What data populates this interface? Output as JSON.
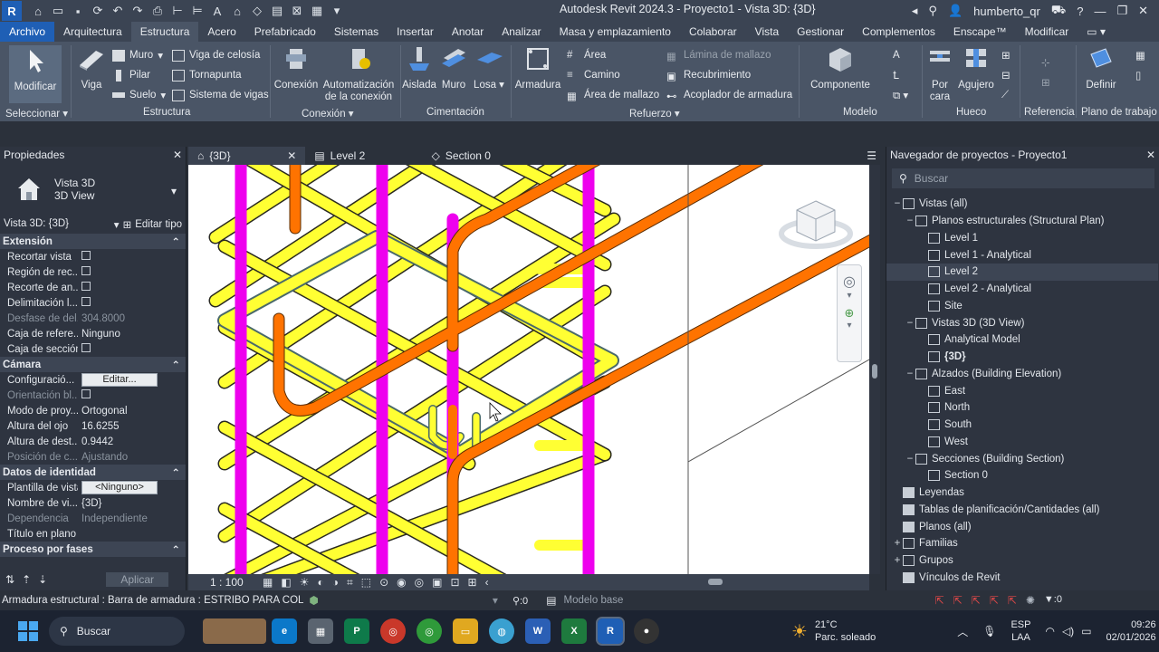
{
  "app": {
    "title": "Autodesk Revit 2024.3 - Proyecto1 - Vista 3D: {3D}",
    "logo": "R",
    "user": "humberto_qr"
  },
  "menu": [
    "Archivo",
    "Arquitectura",
    "Estructura",
    "Acero",
    "Prefabricado",
    "Sistemas",
    "Insertar",
    "Anotar",
    "Analizar",
    "Masa y emplazamiento",
    "Colaborar",
    "Vista",
    "Gestionar",
    "Complementos",
    "Enscape™",
    "Modificar"
  ],
  "ribbon": {
    "seleccionar": {
      "btn": "Modificar",
      "label": "Seleccionar"
    },
    "estructura": {
      "viga": "Viga",
      "muro": "Muro",
      "pilar": "Pilar",
      "suelo": "Suelo",
      "celosia": "Viga de celosía",
      "tornapunta": "Tornapunta",
      "sistema": "Sistema de vigas",
      "label": "Estructura"
    },
    "conexion": {
      "conexion": "Conexión",
      "auto1": "Automatización",
      "auto2": "de la conexión",
      "label": "Conexión"
    },
    "cimentacion": {
      "aislada": "Aislada",
      "muro": "Muro",
      "losa": "Losa",
      "label": "Cimentación"
    },
    "refuerzo": {
      "armadura": "Armadura",
      "area": "Área",
      "camino": "Camino",
      "area_mallazo": "Área de mallazo",
      "lamina": "Lámina de mallazo",
      "recubrimiento": "Recubrimiento",
      "acoplador": "Acoplador de armadura",
      "label": "Refuerzo"
    },
    "modelo": {
      "componente": "Componente",
      "label": "Modelo"
    },
    "hueco": {
      "porcara1": "Por",
      "porcara2": "cara",
      "agujero": "Agujero",
      "label": "Hueco"
    },
    "referencia": {
      "label": "Referencia"
    },
    "plano": {
      "definir": "Definir",
      "label": "Plano de trabajo"
    }
  },
  "properties": {
    "title": "Propiedades",
    "type_name": "Vista 3D",
    "type_sub": "3D View",
    "selector": "Vista 3D: {3D}",
    "edit_type": "Editar tipo",
    "sections": [
      {
        "name": "Extensión",
        "rows": [
          {
            "k": "Recortar vista",
            "check": true
          },
          {
            "k": "Región de rec...",
            "check": true
          },
          {
            "k": "Recorte de an...",
            "check": true
          },
          {
            "k": "Delimitación l...",
            "check": true
          },
          {
            "k": "Desfase de del...",
            "v": "304.8000",
            "dis": true
          },
          {
            "k": "Caja de refere...",
            "v": "Ninguno"
          },
          {
            "k": "Caja de sección",
            "check": true
          }
        ]
      },
      {
        "name": "Cámara",
        "rows": [
          {
            "k": "Configuració...",
            "btn": "Editar..."
          },
          {
            "k": "Orientación bl...",
            "check": true,
            "dis": true
          },
          {
            "k": "Modo de proy...",
            "v": "Ortogonal"
          },
          {
            "k": "Altura del ojo",
            "v": "16.6255"
          },
          {
            "k": "Altura de dest...",
            "v": "0.9442"
          },
          {
            "k": "Posición de c...",
            "v": "Ajustando",
            "dis": true
          }
        ]
      },
      {
        "name": "Datos de identidad",
        "rows": [
          {
            "k": "Plantilla de vista",
            "btn": "<Ninguno>"
          },
          {
            "k": "Nombre de vi...",
            "v": "{3D}"
          },
          {
            "k": "Dependencia",
            "v": "Independiente",
            "dis": true
          },
          {
            "k": "Título en plano",
            "v": ""
          }
        ]
      },
      {
        "name": "Proceso por fases",
        "rows": []
      }
    ],
    "apply": "Aplicar"
  },
  "viewtabs": [
    "{3D}",
    "Level 2",
    "Section 0"
  ],
  "viewbar": {
    "scale": "1 : 100"
  },
  "navigator": {
    "title": "Navegador de proyectos - Proyecto1",
    "search": "Buscar",
    "items": [
      {
        "t": "Vistas (all)",
        "lvl": 0,
        "exp": "−"
      },
      {
        "t": "Planos estructurales (Structural Plan)",
        "lvl": 1,
        "exp": "−"
      },
      {
        "t": "Level 1",
        "lvl": 2
      },
      {
        "t": "Level 1 - Analytical",
        "lvl": 2
      },
      {
        "t": "Level 2",
        "lvl": 2,
        "sel": true
      },
      {
        "t": "Level 2 - Analytical",
        "lvl": 2
      },
      {
        "t": "Site",
        "lvl": 2
      },
      {
        "t": "Vistas 3D (3D View)",
        "lvl": 1,
        "exp": "−"
      },
      {
        "t": "Analytical Model",
        "lvl": 2
      },
      {
        "t": "{3D}",
        "lvl": 2,
        "bold": true
      },
      {
        "t": "Alzados (Building Elevation)",
        "lvl": 1,
        "exp": "−"
      },
      {
        "t": "East",
        "lvl": 2
      },
      {
        "t": "North",
        "lvl": 2
      },
      {
        "t": "South",
        "lvl": 2
      },
      {
        "t": "West",
        "lvl": 2
      },
      {
        "t": "Secciones (Building Section)",
        "lvl": 1,
        "exp": "−"
      },
      {
        "t": "Section 0",
        "lvl": 2
      },
      {
        "t": "Leyendas",
        "lvl": 0
      },
      {
        "t": "Tablas de planificación/Cantidades (all)",
        "lvl": 0
      },
      {
        "t": "Planos (all)",
        "lvl": 0
      },
      {
        "t": "Familias",
        "lvl": 0,
        "exp": "+"
      },
      {
        "t": "Grupos",
        "lvl": 0,
        "exp": "+"
      },
      {
        "t": "Vínculos de Revit",
        "lvl": 0
      }
    ]
  },
  "status": {
    "text": "Armadura estructural : Barra de armadura : ESTRIBO PARA COL",
    "count": ":0",
    "model": "Modelo base",
    "filter": ":0"
  },
  "taskbar": {
    "search": "Buscar",
    "temp": "21°C",
    "weather": "Parc. soleado",
    "lang1": "ESP",
    "lang2": "LAA",
    "time": "09:26",
    "date": "02/01/2026"
  },
  "colors": {
    "yellow": "#ffff33",
    "magenta": "#ee00ee",
    "orange": "#ff7300",
    "accent": "#1f5fb5"
  }
}
